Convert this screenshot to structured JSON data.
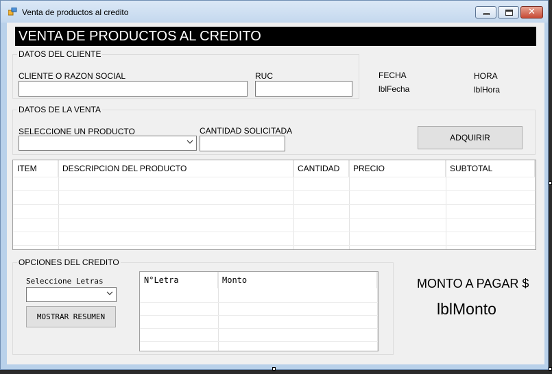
{
  "window": {
    "title": "Venta de productos al credito"
  },
  "banner": {
    "text": "VENTA DE PRODUCTOS AL CREDITO"
  },
  "cliente": {
    "legend": "DATOS DEL CLIENTE",
    "nombre_label": "CLIENTE O RAZON SOCIAL",
    "nombre_value": "",
    "ruc_label": "RUC",
    "ruc_value": ""
  },
  "fecha": {
    "label": "FECHA",
    "value": "lblFecha"
  },
  "hora": {
    "label": "HORA",
    "value": "lblHora"
  },
  "venta": {
    "legend": "DATOS DE LA VENTA",
    "producto_label": "SELECCIONE UN PRODUCTO",
    "producto_value": "",
    "cantidad_label": "CANTIDAD SOLICITADA",
    "cantidad_value": "",
    "adquirir_button": "ADQUIRIR"
  },
  "productos_grid": {
    "columns": [
      "ITEM",
      "DESCRIPCION DEL PRODUCTO",
      "CANTIDAD",
      "PRECIO",
      "SUBTOTAL"
    ],
    "rows": []
  },
  "credito": {
    "legend": "OPCIONES DEL CREDITO",
    "letras_label": "Seleccione Letras",
    "letras_value": "",
    "resumen_button": "MOSTRAR RESUMEN"
  },
  "letras_grid": {
    "columns": [
      "N°Letra",
      "Monto"
    ],
    "rows": []
  },
  "monto": {
    "label": "MONTO A PAGAR $",
    "value": "lblMonto"
  },
  "colors": {
    "banner_bg": "#000000",
    "banner_fg": "#ffffff",
    "form_bg": "#f0f0f0",
    "frame": "#b9d1ea",
    "close_button": "#c74a35"
  }
}
